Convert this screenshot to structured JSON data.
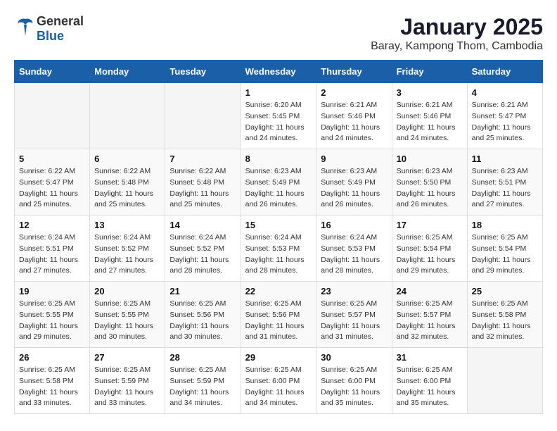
{
  "header": {
    "logo_general": "General",
    "logo_blue": "Blue",
    "title": "January 2025",
    "subtitle": "Baray, Kampong Thom, Cambodia"
  },
  "calendar": {
    "days_of_week": [
      "Sunday",
      "Monday",
      "Tuesday",
      "Wednesday",
      "Thursday",
      "Friday",
      "Saturday"
    ],
    "weeks": [
      [
        {
          "day": "",
          "info": ""
        },
        {
          "day": "",
          "info": ""
        },
        {
          "day": "",
          "info": ""
        },
        {
          "day": "1",
          "info": "Sunrise: 6:20 AM\nSunset: 5:45 PM\nDaylight: 11 hours and 24 minutes."
        },
        {
          "day": "2",
          "info": "Sunrise: 6:21 AM\nSunset: 5:46 PM\nDaylight: 11 hours and 24 minutes."
        },
        {
          "day": "3",
          "info": "Sunrise: 6:21 AM\nSunset: 5:46 PM\nDaylight: 11 hours and 24 minutes."
        },
        {
          "day": "4",
          "info": "Sunrise: 6:21 AM\nSunset: 5:47 PM\nDaylight: 11 hours and 25 minutes."
        }
      ],
      [
        {
          "day": "5",
          "info": "Sunrise: 6:22 AM\nSunset: 5:47 PM\nDaylight: 11 hours and 25 minutes."
        },
        {
          "day": "6",
          "info": "Sunrise: 6:22 AM\nSunset: 5:48 PM\nDaylight: 11 hours and 25 minutes."
        },
        {
          "day": "7",
          "info": "Sunrise: 6:22 AM\nSunset: 5:48 PM\nDaylight: 11 hours and 25 minutes."
        },
        {
          "day": "8",
          "info": "Sunrise: 6:23 AM\nSunset: 5:49 PM\nDaylight: 11 hours and 26 minutes."
        },
        {
          "day": "9",
          "info": "Sunrise: 6:23 AM\nSunset: 5:49 PM\nDaylight: 11 hours and 26 minutes."
        },
        {
          "day": "10",
          "info": "Sunrise: 6:23 AM\nSunset: 5:50 PM\nDaylight: 11 hours and 26 minutes."
        },
        {
          "day": "11",
          "info": "Sunrise: 6:23 AM\nSunset: 5:51 PM\nDaylight: 11 hours and 27 minutes."
        }
      ],
      [
        {
          "day": "12",
          "info": "Sunrise: 6:24 AM\nSunset: 5:51 PM\nDaylight: 11 hours and 27 minutes."
        },
        {
          "day": "13",
          "info": "Sunrise: 6:24 AM\nSunset: 5:52 PM\nDaylight: 11 hours and 27 minutes."
        },
        {
          "day": "14",
          "info": "Sunrise: 6:24 AM\nSunset: 5:52 PM\nDaylight: 11 hours and 28 minutes."
        },
        {
          "day": "15",
          "info": "Sunrise: 6:24 AM\nSunset: 5:53 PM\nDaylight: 11 hours and 28 minutes."
        },
        {
          "day": "16",
          "info": "Sunrise: 6:24 AM\nSunset: 5:53 PM\nDaylight: 11 hours and 28 minutes."
        },
        {
          "day": "17",
          "info": "Sunrise: 6:25 AM\nSunset: 5:54 PM\nDaylight: 11 hours and 29 minutes."
        },
        {
          "day": "18",
          "info": "Sunrise: 6:25 AM\nSunset: 5:54 PM\nDaylight: 11 hours and 29 minutes."
        }
      ],
      [
        {
          "day": "19",
          "info": "Sunrise: 6:25 AM\nSunset: 5:55 PM\nDaylight: 11 hours and 29 minutes."
        },
        {
          "day": "20",
          "info": "Sunrise: 6:25 AM\nSunset: 5:55 PM\nDaylight: 11 hours and 30 minutes."
        },
        {
          "day": "21",
          "info": "Sunrise: 6:25 AM\nSunset: 5:56 PM\nDaylight: 11 hours and 30 minutes."
        },
        {
          "day": "22",
          "info": "Sunrise: 6:25 AM\nSunset: 5:56 PM\nDaylight: 11 hours and 31 minutes."
        },
        {
          "day": "23",
          "info": "Sunrise: 6:25 AM\nSunset: 5:57 PM\nDaylight: 11 hours and 31 minutes."
        },
        {
          "day": "24",
          "info": "Sunrise: 6:25 AM\nSunset: 5:57 PM\nDaylight: 11 hours and 32 minutes."
        },
        {
          "day": "25",
          "info": "Sunrise: 6:25 AM\nSunset: 5:58 PM\nDaylight: 11 hours and 32 minutes."
        }
      ],
      [
        {
          "day": "26",
          "info": "Sunrise: 6:25 AM\nSunset: 5:58 PM\nDaylight: 11 hours and 33 minutes."
        },
        {
          "day": "27",
          "info": "Sunrise: 6:25 AM\nSunset: 5:59 PM\nDaylight: 11 hours and 33 minutes."
        },
        {
          "day": "28",
          "info": "Sunrise: 6:25 AM\nSunset: 5:59 PM\nDaylight: 11 hours and 34 minutes."
        },
        {
          "day": "29",
          "info": "Sunrise: 6:25 AM\nSunset: 6:00 PM\nDaylight: 11 hours and 34 minutes."
        },
        {
          "day": "30",
          "info": "Sunrise: 6:25 AM\nSunset: 6:00 PM\nDaylight: 11 hours and 35 minutes."
        },
        {
          "day": "31",
          "info": "Sunrise: 6:25 AM\nSunset: 6:00 PM\nDaylight: 11 hours and 35 minutes."
        },
        {
          "day": "",
          "info": ""
        }
      ]
    ]
  }
}
